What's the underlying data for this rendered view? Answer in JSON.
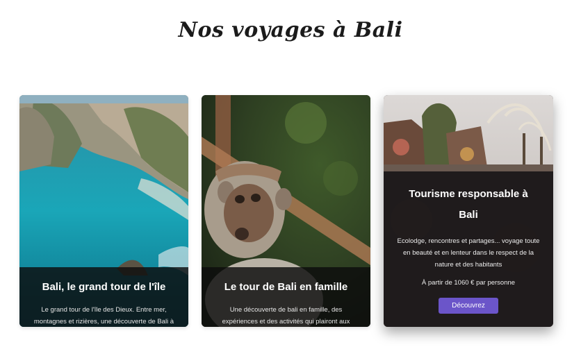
{
  "page": {
    "title": "Nos voyages à Bali"
  },
  "cards": [
    {
      "title": "Bali, le grand tour de l'île",
      "description": "Le grand tour de l'île des Dieux. Entre mer, montagnes et rizières, une découverte de Bali à"
    },
    {
      "title": "Le tour de Bali en famille",
      "description": "Une découverte de bali en famille, des expériences et des activités qui plairont aux"
    },
    {
      "title": "Tourisme responsable à Bali",
      "description": "Ecolodge, rencontres et partages... voyage toute en beauté et en lenteur dans le respect de la nature et des habitants",
      "price": "À partir de 1060 € par personne",
      "button_label": "Découvrez"
    }
  ],
  "colors": {
    "accent": "#6b55c9"
  }
}
